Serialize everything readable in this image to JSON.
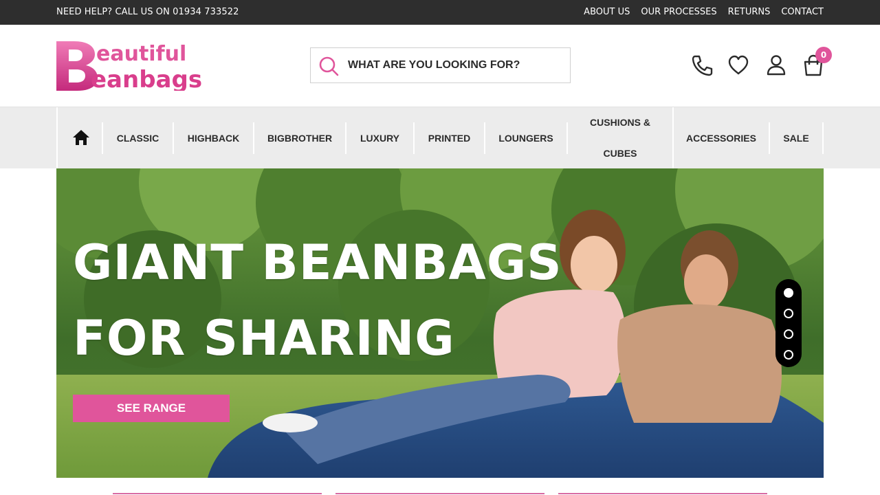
{
  "topbar": {
    "help_text": "NEED HELP? CALL US ON 01934 733522",
    "links": [
      "ABOUT US",
      "OUR PROCESSES",
      "RETURNS",
      "CONTACT"
    ]
  },
  "header": {
    "logo_text": "Beautiful Beanbags",
    "search_placeholder": "WHAT ARE YOU LOOKING FOR?",
    "cart_count": "0",
    "icons": [
      "phone-icon",
      "heart-icon",
      "user-icon",
      "cart-icon"
    ]
  },
  "nav": {
    "items": [
      "CLASSIC",
      "HIGHBACK",
      "BIGBROTHER",
      "LUXURY",
      "PRINTED",
      "LOUNGERS",
      "CUSHIONS &",
      "CUBES",
      "ACCESSORIES",
      "SALE"
    ]
  },
  "hero": {
    "headline_line1": "GIANT BEANBAGS",
    "headline_line2": "FOR SHARING",
    "cta_label": "SEE RANGE",
    "slide_count": 4,
    "active_slide": 1
  },
  "colors": {
    "brand_pink": "#e0559b",
    "topbar_bg": "#2e2e2e",
    "nav_bg": "#ececec"
  }
}
